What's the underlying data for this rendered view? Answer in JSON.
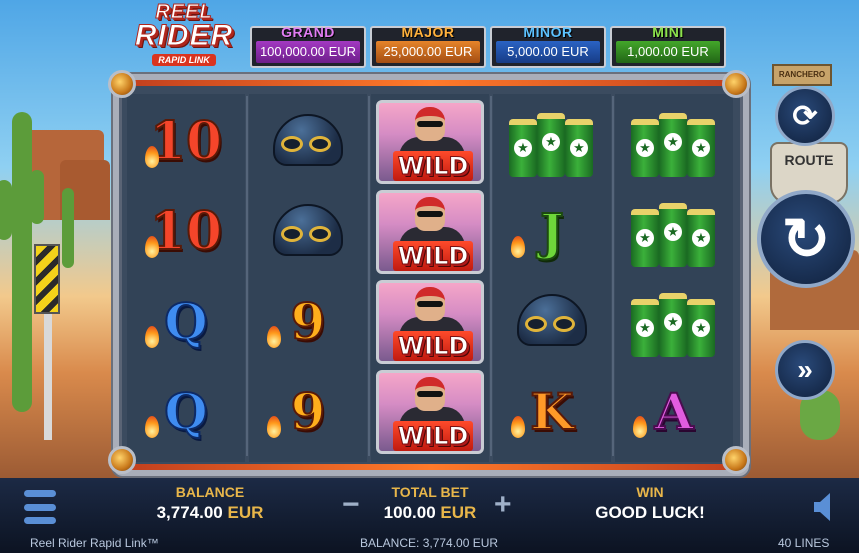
{
  "game": {
    "logo_line1": "REEL",
    "logo_line2": "RIDER",
    "logo_line3": "RAPID LINK"
  },
  "jackpots": [
    {
      "name": "GRAND",
      "value": "100,000.00 EUR"
    },
    {
      "name": "MAJOR",
      "value": "25,000.00 EUR"
    },
    {
      "name": "MINOR",
      "value": "5,000.00 EUR"
    },
    {
      "name": "MINI",
      "value": "1,000.00 EUR"
    }
  ],
  "reels": [
    [
      "10",
      "10",
      "Q",
      "Q"
    ],
    [
      "helmet",
      "helmet",
      "9",
      "9"
    ],
    [
      "WILD",
      "WILD",
      "WILD",
      "WILD"
    ],
    [
      "beer-cans",
      "J",
      "helmet",
      "K"
    ],
    [
      "beer-cans",
      "beer-cans",
      "beer-cans",
      "A"
    ]
  ],
  "scenery": {
    "route_sign": "ROUTE",
    "ranch_sign": "RANCHERO"
  },
  "controls": {
    "autoplay_icon": "autoplay-icon",
    "spin_icon": "spin-icon",
    "turbo_icon": "fast-forward-icon",
    "menu_icon": "hamburger-menu-icon",
    "sound_icon": "speaker-icon"
  },
  "stats": {
    "balance_label": "BALANCE",
    "balance_value": "3,774.00",
    "balance_currency": "EUR",
    "bet_label": "TOTAL BET",
    "bet_value": "100.00",
    "bet_currency": "EUR",
    "win_label": "WIN",
    "win_value": "GOOD LUCK!",
    "minus": "−",
    "plus": "+"
  },
  "footer": {
    "game_name": "Reel Rider Rapid Link™",
    "balance": "BALANCE: 3,774.00 EUR",
    "lines": "40 LINES"
  },
  "colors": {
    "balance_label": "#e8b64a",
    "grand": "#a339c2",
    "major": "#e6842a",
    "minor": "#2a63c4",
    "mini": "#43a62a"
  }
}
